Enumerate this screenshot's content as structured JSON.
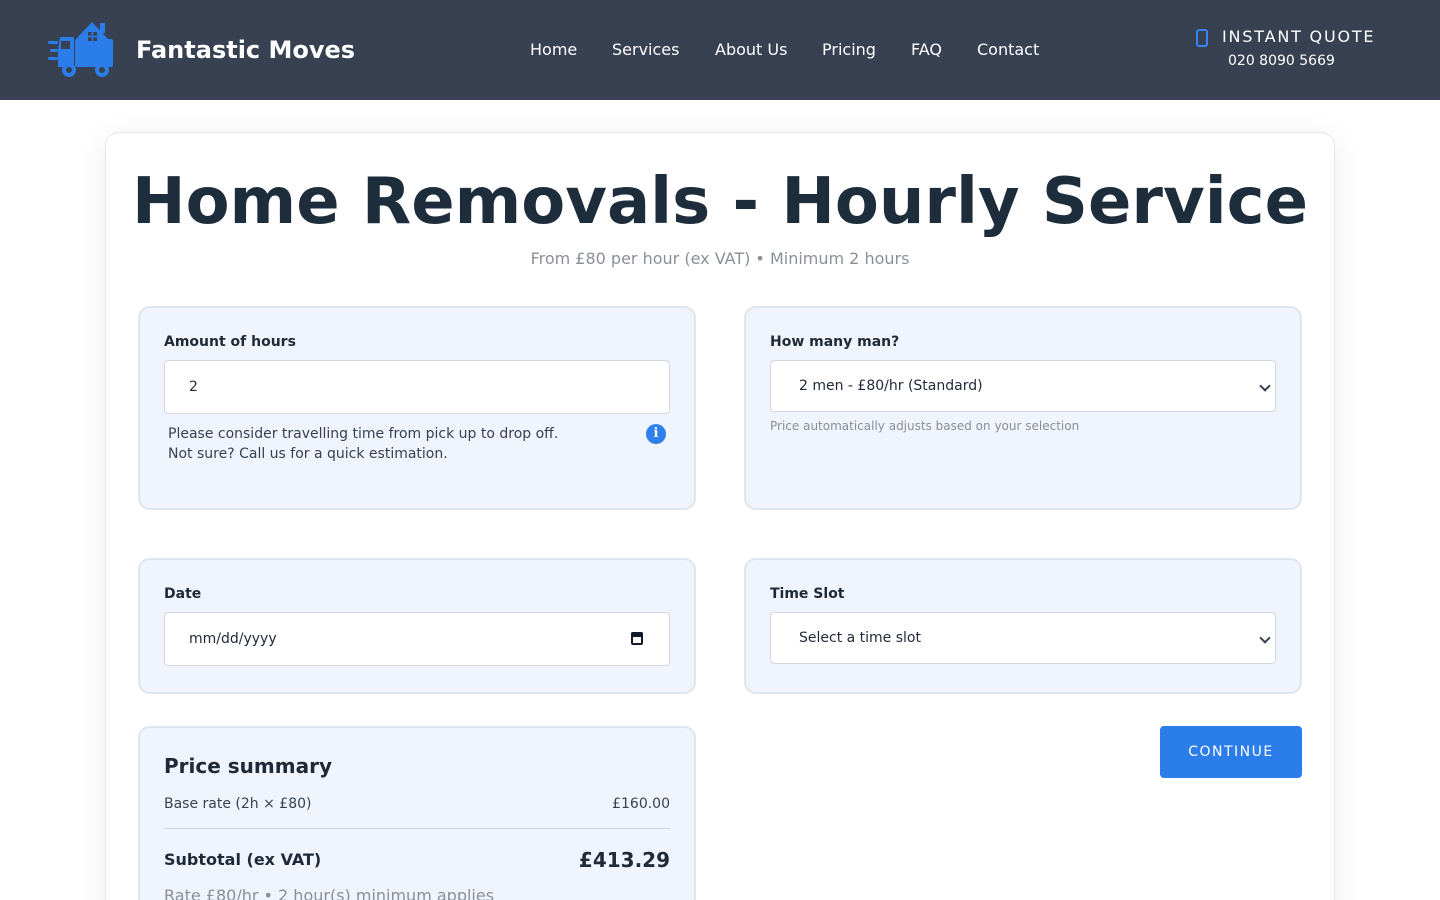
{
  "brand": {
    "name": "Fantastic Moves",
    "logo_icon": "moving-truck-house-icon",
    "accent_color": "#2b7de9"
  },
  "nav": {
    "items": [
      {
        "label": "Home"
      },
      {
        "label": "Services"
      },
      {
        "label": "About Us"
      },
      {
        "label": "Pricing"
      },
      {
        "label": "FAQ"
      },
      {
        "label": "Contact"
      }
    ]
  },
  "quote": {
    "icon": "phone-icon",
    "label": "INSTANT QUOTE",
    "phone": "020 8090 5669"
  },
  "page": {
    "title": "Home Removals - Hourly Service",
    "subtitle": "From £80 per hour (ex VAT) • Minimum 2 hours"
  },
  "form": {
    "hours": {
      "label": "Amount of hours",
      "value": "2",
      "help_line1": "Please consider travelling time from pick up to drop off.",
      "help_line2": "Not sure? Call us for a quick estimation.",
      "info_icon": "i"
    },
    "men": {
      "label": "How many man?",
      "selected": "2 men - £80/hr (Standard)",
      "note": "Price automatically adjusts based on your selection"
    },
    "date": {
      "label": "Date",
      "placeholder": "mm/dd/yyyy"
    },
    "time_slot": {
      "label": "Time Slot",
      "selected": "Select a time slot"
    }
  },
  "summary": {
    "title": "Price summary",
    "base_rate_label": "Base rate (2h × £80)",
    "base_rate_value": "£160.00",
    "subtotal_label": "Subtotal (ex VAT)",
    "subtotal_value": "£413.29",
    "note": "Rate £80/hr • 2 hour(s) minimum applies"
  },
  "actions": {
    "continue_label": "CONTINUE"
  }
}
